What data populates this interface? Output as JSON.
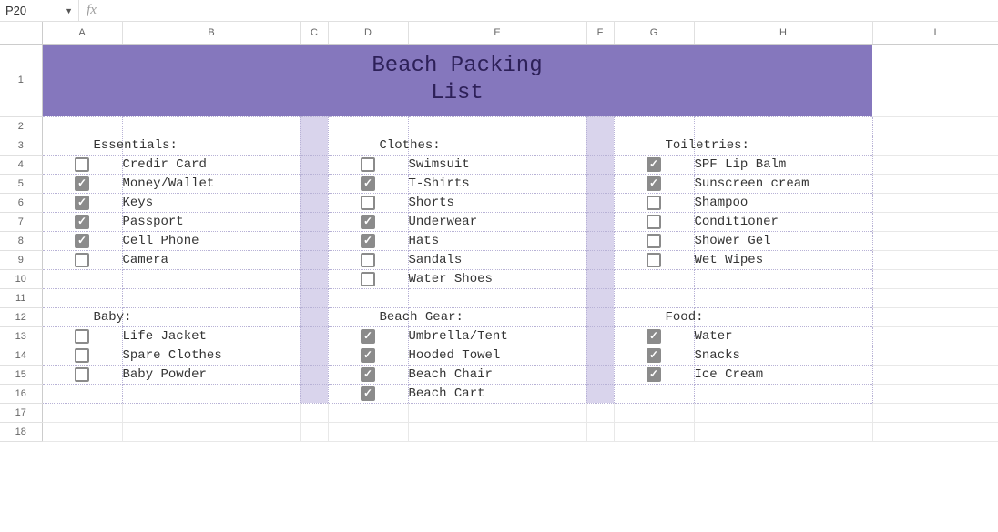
{
  "cell_ref": "P20",
  "fx_label": "fx",
  "formula_value": "",
  "col_headers": [
    "A",
    "B",
    "C",
    "D",
    "E",
    "F",
    "G",
    "H",
    "I"
  ],
  "row_headers": [
    "1",
    "2",
    "3",
    "4",
    "5",
    "6",
    "7",
    "8",
    "9",
    "10",
    "11",
    "12",
    "13",
    "14",
    "15",
    "16",
    "17",
    "18"
  ],
  "title": "Beach Packing\nList",
  "sections": {
    "essentials": {
      "heading": "Essentials:",
      "items": [
        {
          "label": "Credir Card",
          "checked": false
        },
        {
          "label": "Money/Wallet",
          "checked": true
        },
        {
          "label": "Keys",
          "checked": true
        },
        {
          "label": "Passport",
          "checked": true
        },
        {
          "label": "Cell Phone",
          "checked": true
        },
        {
          "label": "Camera",
          "checked": false
        }
      ]
    },
    "clothes": {
      "heading": "Clothes:",
      "items": [
        {
          "label": "Swimsuit",
          "checked": false
        },
        {
          "label": "T-Shirts",
          "checked": true
        },
        {
          "label": "Shorts",
          "checked": false
        },
        {
          "label": "Underwear",
          "checked": true
        },
        {
          "label": "Hats",
          "checked": true
        },
        {
          "label": "Sandals",
          "checked": false
        },
        {
          "label": "Water Shoes",
          "checked": false
        }
      ]
    },
    "toiletries": {
      "heading": "Toiletries:",
      "items": [
        {
          "label": "SPF Lip Balm",
          "checked": true
        },
        {
          "label": "Sunscreen cream",
          "checked": true
        },
        {
          "label": "Shampoo",
          "checked": false
        },
        {
          "label": "Conditioner",
          "checked": false
        },
        {
          "label": "Shower Gel",
          "checked": false
        },
        {
          "label": "Wet Wipes",
          "checked": false
        }
      ]
    },
    "baby": {
      "heading": "Baby:",
      "items": [
        {
          "label": "Life Jacket",
          "checked": false
        },
        {
          "label": "Spare Clothes",
          "checked": false
        },
        {
          "label": "Baby Powder",
          "checked": false
        }
      ]
    },
    "beach_gear": {
      "heading": "Beach Gear:",
      "items": [
        {
          "label": "Umbrella/Tent",
          "checked": true
        },
        {
          "label": "Hooded Towel",
          "checked": true
        },
        {
          "label": "Beach Chair",
          "checked": true
        },
        {
          "label": "Beach Cart",
          "checked": true
        }
      ]
    },
    "food": {
      "heading": "Food:",
      "items": [
        {
          "label": "Water",
          "checked": true
        },
        {
          "label": "Snacks",
          "checked": true
        },
        {
          "label": "Ice Cream",
          "checked": true
        }
      ]
    }
  }
}
